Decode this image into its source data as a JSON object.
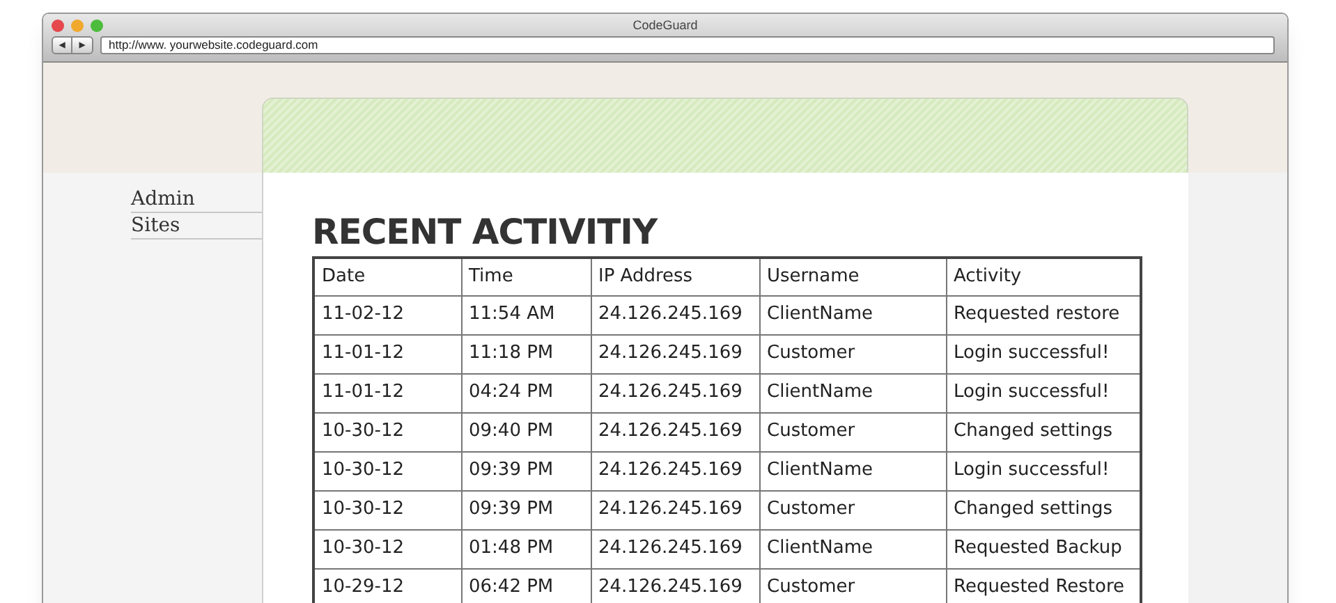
{
  "window": {
    "title": "CodeGuard"
  },
  "toolbar": {
    "back": "◀",
    "forward": "▶",
    "url": "http://www. yourwebsite.codeguard.com"
  },
  "sidebar": {
    "items": [
      {
        "label": "Admin"
      },
      {
        "label": "Sites"
      }
    ]
  },
  "heading": "RECENT ACTIVITIY",
  "table": {
    "columns": [
      "Date",
      "Time",
      "IP Address",
      "Username",
      "Activity"
    ],
    "rows": [
      [
        "11-02-12",
        "11:54 AM",
        "24.126.245.169",
        "ClientName",
        "Requested restore"
      ],
      [
        "11-01-12",
        "11:18 PM",
        "24.126.245.169",
        "Customer",
        "Login successful!"
      ],
      [
        "11-01-12",
        "04:24 PM",
        "24.126.245.169",
        "ClientName",
        "Login successful!"
      ],
      [
        "10-30-12",
        "09:40 PM",
        "24.126.245.169",
        "Customer",
        "Changed settings"
      ],
      [
        "10-30-12",
        "09:39 PM",
        "24.126.245.169",
        "ClientName",
        "Login successful!"
      ],
      [
        "10-30-12",
        "09:39 PM",
        "24.126.245.169",
        "Customer",
        "Changed settings"
      ],
      [
        "10-30-12",
        "01:48 PM",
        "24.126.245.169",
        "ClientName",
        "Requested Backup"
      ],
      [
        "10-29-12",
        "06:42 PM",
        "24.126.245.169",
        "Customer",
        "Requested Restore"
      ]
    ]
  }
}
